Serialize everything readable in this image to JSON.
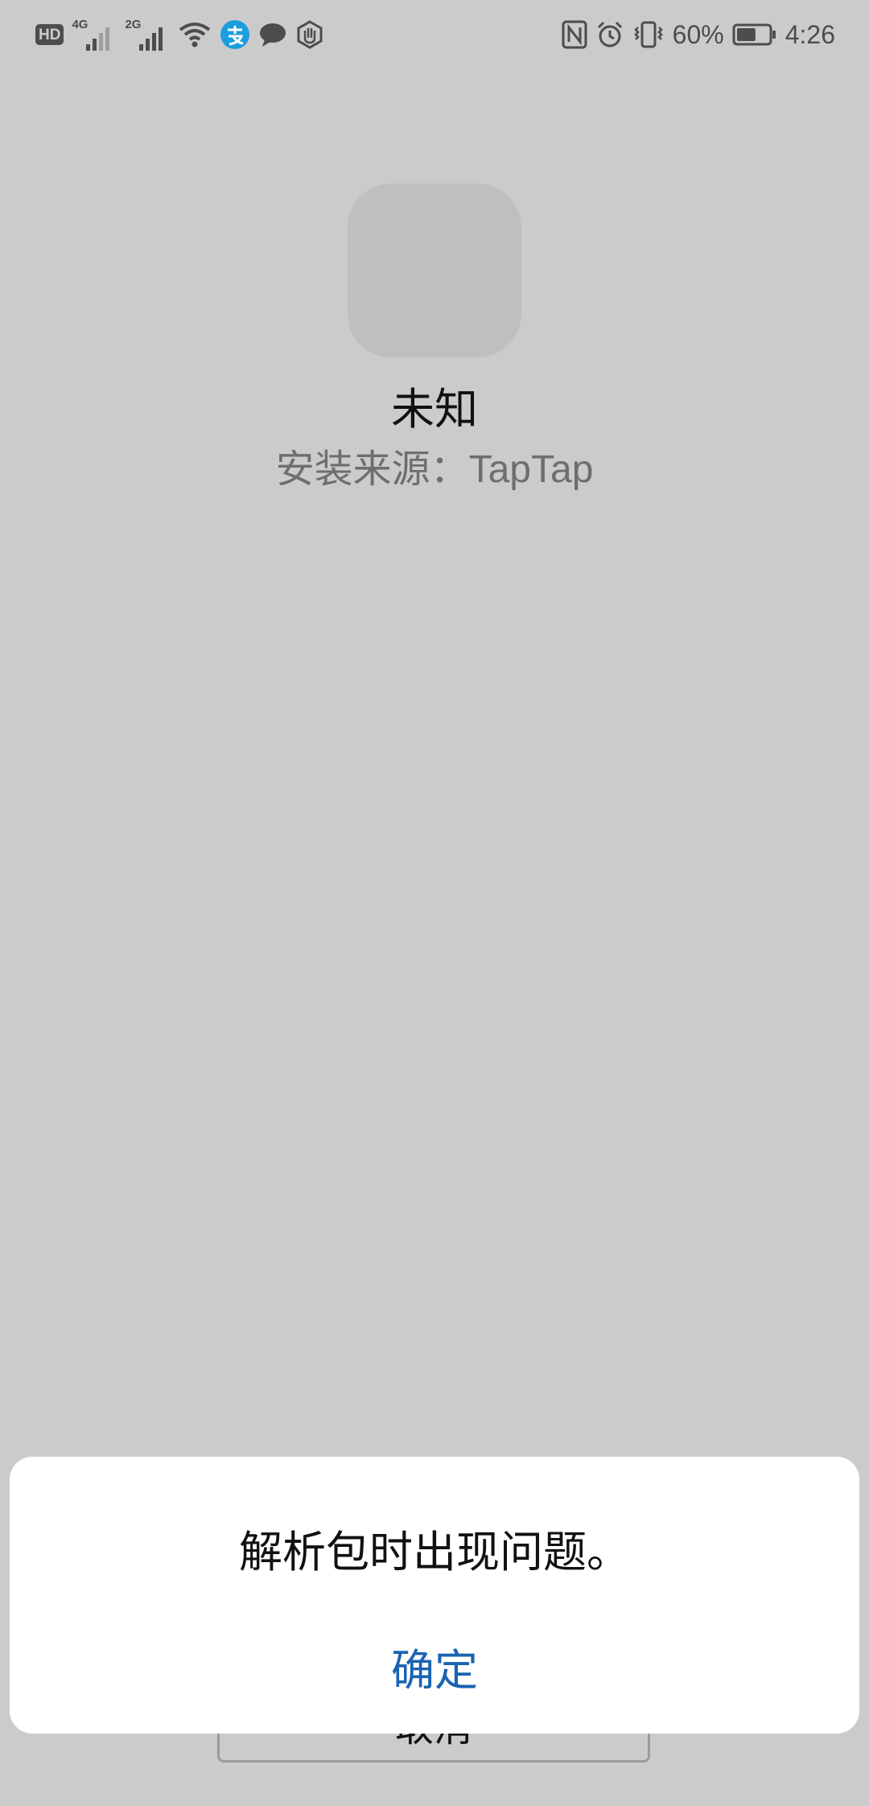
{
  "status_bar": {
    "hd_badge": "HD",
    "network_1": "4G",
    "network_2": "2G",
    "battery_percent": "60%",
    "battery_level": 0.6,
    "time": "4:26",
    "icons_left": [
      "hd-icon",
      "signal-4g-icon",
      "signal-2g-icon",
      "wifi-icon",
      "alipay-icon",
      "message-icon",
      "hand-icon"
    ],
    "icons_right": [
      "nfc-icon",
      "alarm-icon",
      "vibrate-icon",
      "battery-icon"
    ]
  },
  "app": {
    "name": "未知",
    "install_source_label": "安装来源：",
    "install_source_value": "TapTap"
  },
  "background_button": {
    "cancel_label": "取消"
  },
  "dialog": {
    "message": "解析包时出现问题。",
    "ok_label": "确定",
    "ok_color": "#1a63b0"
  }
}
